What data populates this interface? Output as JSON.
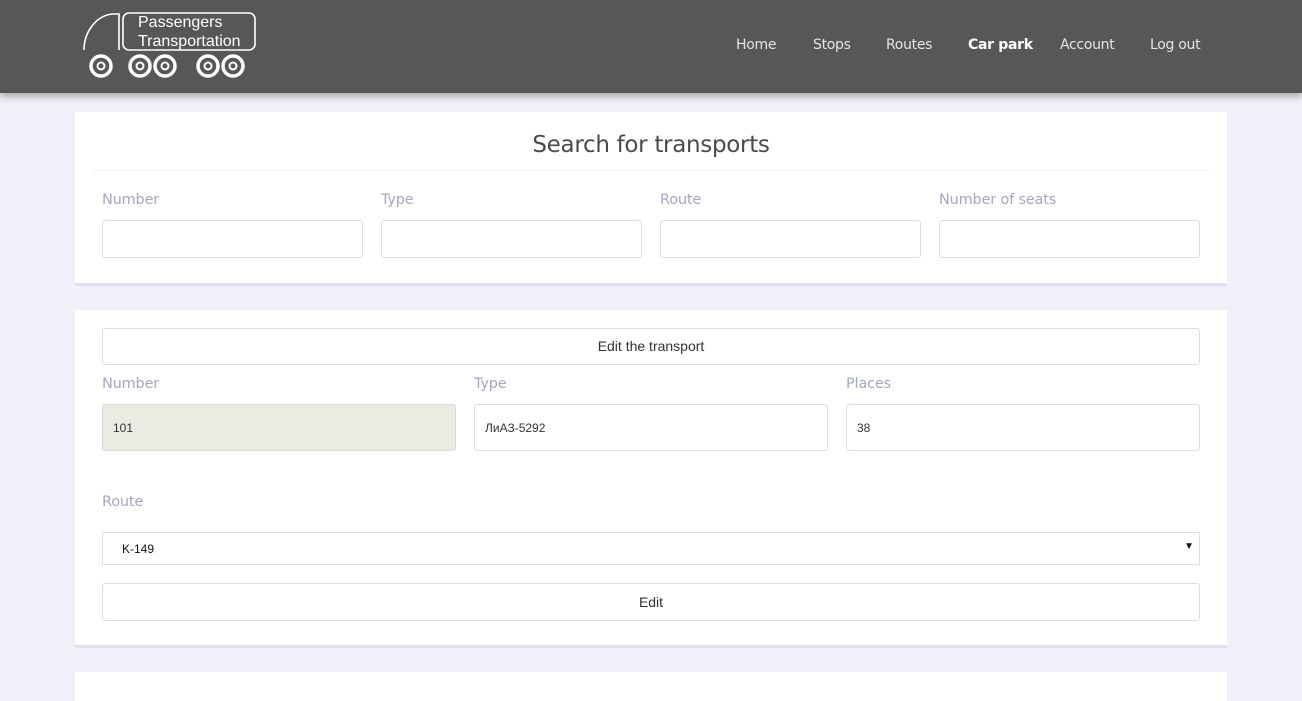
{
  "header": {
    "logo_line1": "Passengers",
    "logo_line2": "Transportation",
    "nav": [
      {
        "label": "Home",
        "active": false
      },
      {
        "label": "Stops",
        "active": false
      },
      {
        "label": "Routes",
        "active": false
      },
      {
        "label": "Car park",
        "active": true
      },
      {
        "label": "Account",
        "active": false
      },
      {
        "label": "Log out",
        "active": false
      }
    ]
  },
  "search": {
    "title": "Search for transports",
    "fields": [
      {
        "label": "Number",
        "value": ""
      },
      {
        "label": "Type",
        "value": ""
      },
      {
        "label": "Route",
        "value": ""
      },
      {
        "label": "Number of seats",
        "value": ""
      }
    ]
  },
  "edit": {
    "header_button": "Edit the transport",
    "number_label": "Number",
    "number_value": "101",
    "type_label": "Type",
    "type_value": "ЛиАЗ-5292",
    "places_label": "Places",
    "places_value": "38",
    "route_label": "Route",
    "route_selected": "K-149",
    "submit_label": "Edit"
  },
  "colors": {
    "header_bg": "#575757",
    "page_bg": "#f0f1f8",
    "label": "#a3a8bf"
  }
}
